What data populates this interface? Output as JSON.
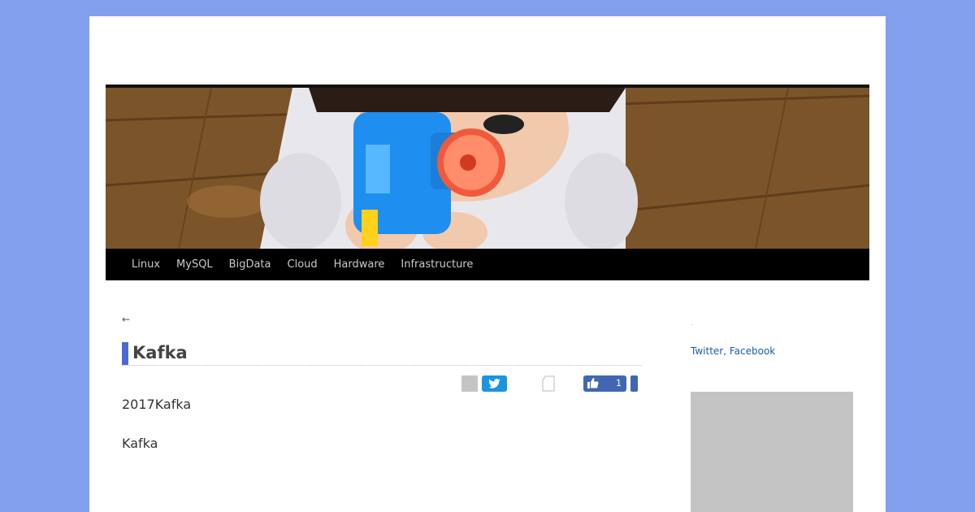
{
  "nav": {
    "items": [
      {
        "label": "Linux"
      },
      {
        "label": "MySQL"
      },
      {
        "label": "BigData"
      },
      {
        "label": "Cloud"
      },
      {
        "label": "Hardware"
      },
      {
        "label": "Infrastructure"
      }
    ]
  },
  "post": {
    "back_arrow": "←",
    "title": "Kafka",
    "paragraphs": [
      "2017Kafka",
      "Kafka"
    ]
  },
  "share": {
    "facebook_count": "1"
  },
  "sidebar": {
    "dot": ".",
    "links": "Twitter, Facebook"
  },
  "colors": {
    "background": "#829fee",
    "accent": "#4a6bd6",
    "twitter": "#1b95e0",
    "facebook": "#4267b2",
    "link": "#1a5fa8"
  }
}
